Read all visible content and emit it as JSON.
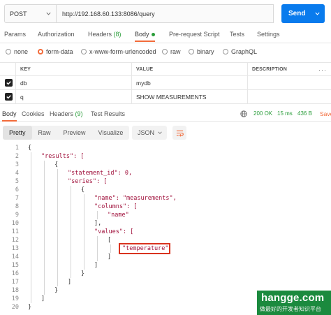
{
  "request": {
    "method": "POST",
    "url": "http://192.168.60.133:8086/query",
    "send_label": "Send"
  },
  "request_tabs": [
    {
      "label": "Params"
    },
    {
      "label": "Authorization"
    },
    {
      "label": "Headers",
      "count": "(8)"
    },
    {
      "label": "Body"
    },
    {
      "label": "Pre-request Script"
    },
    {
      "label": "Tests"
    },
    {
      "label": "Settings"
    }
  ],
  "body_types": [
    "none",
    "form-data",
    "x-www-form-urlencoded",
    "raw",
    "binary",
    "GraphQL"
  ],
  "body_type_selected": "form-data",
  "params_table": {
    "headers": [
      "KEY",
      "VALUE",
      "DESCRIPTION"
    ],
    "more": "···",
    "rows": [
      {
        "key": "db",
        "value": "mydb",
        "description": ""
      },
      {
        "key": "q",
        "value": "SHOW MEASUREMENTS",
        "description": ""
      }
    ]
  },
  "response_tabs": [
    {
      "label": "Body"
    },
    {
      "label": "Cookies"
    },
    {
      "label": "Headers",
      "count": "(9)"
    },
    {
      "label": "Test Results"
    }
  ],
  "response_status": {
    "status": "200 OK",
    "time": "15 ms",
    "size": "436 B",
    "save_label": "Save"
  },
  "viewer": {
    "modes": [
      "Pretty",
      "Raw",
      "Preview",
      "Visualize"
    ],
    "active_mode": "Pretty",
    "format": "JSON"
  },
  "code_lines": [
    {
      "n": "1",
      "text": "{"
    },
    {
      "n": "2",
      "text": "\"results\": ["
    },
    {
      "n": "3",
      "text": "{"
    },
    {
      "n": "4",
      "text": "\"statement_id\": 0,"
    },
    {
      "n": "5",
      "text": "\"series\": ["
    },
    {
      "n": "6",
      "text": "{"
    },
    {
      "n": "7",
      "text": "\"name\": \"measurements\","
    },
    {
      "n": "8",
      "text": "\"columns\": ["
    },
    {
      "n": "9",
      "text": "\"name\""
    },
    {
      "n": "10",
      "text": "],"
    },
    {
      "n": "11",
      "text": "\"values\": ["
    },
    {
      "n": "12",
      "text": "["
    },
    {
      "n": "13",
      "text": "\"temperature\""
    },
    {
      "n": "14",
      "text": "]"
    },
    {
      "n": "15",
      "text": "]"
    },
    {
      "n": "16",
      "text": "}"
    },
    {
      "n": "17",
      "text": "]"
    },
    {
      "n": "18",
      "text": "}"
    },
    {
      "n": "19",
      "text": "]"
    },
    {
      "n": "20",
      "text": "}"
    }
  ],
  "watermark": {
    "site": "hangge.com",
    "tagline": "做最好的开发者知识平台"
  },
  "colors": {
    "accent": "#f26b3a",
    "send_button": "#097bed",
    "success": "#2a9d3a",
    "highlight_box": "#d9331f",
    "watermark_bg": "#1b8a3e"
  },
  "icons": [
    "chevron-down-icon",
    "check-icon",
    "globe-icon",
    "wrap-lines-icon"
  ]
}
